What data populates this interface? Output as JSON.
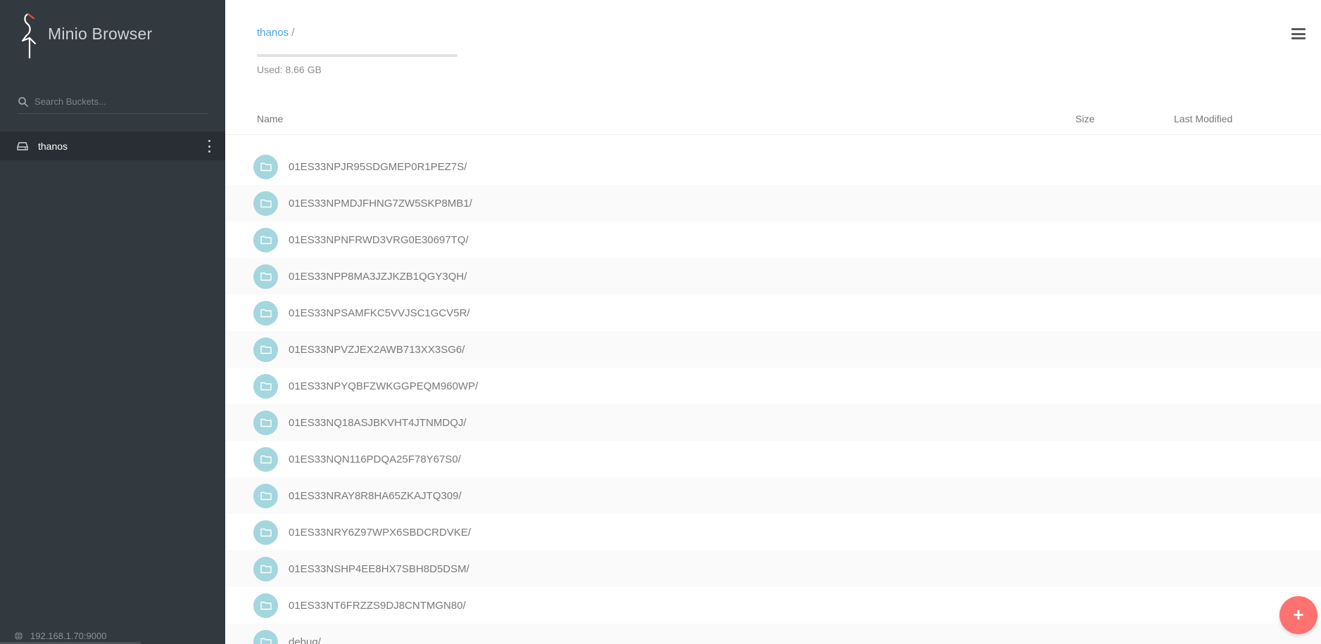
{
  "sidebar": {
    "brand_title": "Minio Browser",
    "search_placeholder": "Search Buckets...",
    "buckets": [
      {
        "name": "thanos",
        "icon": "drive-icon",
        "active": true
      }
    ],
    "host": "192.168.1.70:9000",
    "host_icon": "globe-icon"
  },
  "header": {
    "breadcrumb_bucket": "thanos",
    "breadcrumb_sep": "/",
    "usage_text": "Used: 8.66 GB"
  },
  "table": {
    "col_name": "Name",
    "col_size": "Size",
    "col_modified": "Last Modified",
    "rows": [
      {
        "name": "01ES33NPJR95SDGMEP0R1PEZ7S/"
      },
      {
        "name": "01ES33NPMDJFHNG7ZW5SKP8MB1/"
      },
      {
        "name": "01ES33NPNFRWD3VRG0E30697TQ/"
      },
      {
        "name": "01ES33NPP8MA3JZJKZB1QGY3QH/"
      },
      {
        "name": "01ES33NPSAMFKC5VVJSC1GCV5R/"
      },
      {
        "name": "01ES33NPVZJEX2AWB713XX3SG6/"
      },
      {
        "name": "01ES33NPYQBFZWKGGPEQM960WP/"
      },
      {
        "name": "01ES33NQ18ASJBKVHT4JTNMDQJ/"
      },
      {
        "name": "01ES33NQN116PDQA25F78Y67S0/"
      },
      {
        "name": "01ES33NRAY8R8HA65ZKAJTQ309/"
      },
      {
        "name": "01ES33NRY6Z97WPX6SBDCRDVKE/"
      },
      {
        "name": "01ES33NSHP4EE8HX7SBH8D5DSM/"
      },
      {
        "name": "01ES33NT6FRZZS9DJ8CNTMGN80/"
      },
      {
        "name": "debug/"
      }
    ]
  },
  "fab": {
    "label": "+"
  },
  "colors": {
    "sidebar_bg": "#32393f",
    "active_bucket_bg": "#282e33",
    "link": "#46a5e0",
    "folder_badge": "#a4d6de",
    "fab": "#ff726f"
  }
}
